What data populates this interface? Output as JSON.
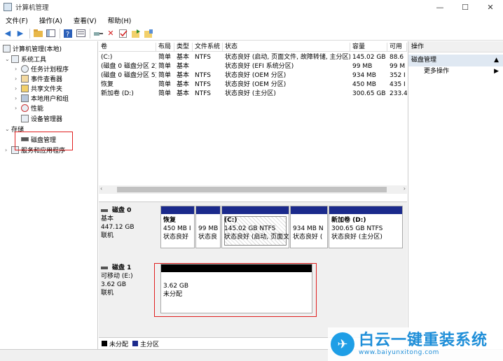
{
  "window": {
    "title": "计算机管理",
    "min": "—",
    "max": "☐",
    "close": "✕"
  },
  "menu": [
    "文件(F)",
    "操作(A)",
    "查看(V)",
    "帮助(H)"
  ],
  "tree": {
    "root": "计算机管理(本地)",
    "system_tools": "系统工具",
    "task_scheduler": "任务计划程序",
    "event_viewer": "事件查看器",
    "shared_folders": "共享文件夹",
    "local_users": "本地用户和组",
    "performance": "性能",
    "device_manager": "设备管理器",
    "storage": "存储",
    "disk_management": "磁盘管理",
    "services": "服务和应用程序"
  },
  "table": {
    "headers": [
      "卷",
      "布局",
      "类型",
      "文件系统",
      "状态",
      "容量",
      "可用"
    ],
    "rows": [
      [
        "(C:)",
        "简单",
        "基本",
        "NTFS",
        "状态良好 (启动, 页面文件, 故障转储, 主分区)",
        "145.02 GB",
        "88.6"
      ],
      [
        "(磁盘 0 磁盘分区 2)",
        "简单",
        "基本",
        "",
        "状态良好 (EFI 系统分区)",
        "99 MB",
        "99 M"
      ],
      [
        "(磁盘 0 磁盘分区 5)",
        "简单",
        "基本",
        "NTFS",
        "状态良好 (OEM 分区)",
        "934 MB",
        "352 I"
      ],
      [
        "恢复",
        "简单",
        "基本",
        "NTFS",
        "状态良好 (OEM 分区)",
        "450 MB",
        "435 I"
      ],
      [
        "新加卷 (D:)",
        "简单",
        "基本",
        "NTFS",
        "状态良好 (主分区)",
        "300.65 GB",
        "233.4"
      ]
    ]
  },
  "disk0": {
    "name": "磁盘 0",
    "type": "基本",
    "size": "447.12 GB",
    "status": "联机",
    "partitions": [
      {
        "title": "恢复",
        "l1": "450 MB I",
        "l2": "状态良好"
      },
      {
        "title": "",
        "l1": "99 MB",
        "l2": "状态良"
      },
      {
        "title": "(C:)",
        "l1": "145.02 GB NTFS",
        "l2": "状态良好 (启动, 页面文"
      },
      {
        "title": "",
        "l1": "934 MB N",
        "l2": "状态良好 ("
      },
      {
        "title": "新加卷 (D:)",
        "l1": "300.65 GB NTFS",
        "l2": "状态良好 (主分区)"
      }
    ]
  },
  "disk1": {
    "name": "磁盘 1",
    "type": "可移动 (E:)",
    "size": "3.62 GB",
    "status": "联机",
    "partition": {
      "l1": "3.62 GB",
      "l2": "未分配"
    }
  },
  "legend": {
    "unallocated": "未分配",
    "primary": "主分区"
  },
  "actions": {
    "header": "操作",
    "section": "磁盘管理",
    "more": "更多操作"
  },
  "watermark": {
    "brand": "白云一键重装系统",
    "url": "www.baiyunxitong.com"
  },
  "colors": {
    "primary_partition": "#1b2a8c",
    "unallocated": "#000000",
    "highlight": "#e02020"
  }
}
